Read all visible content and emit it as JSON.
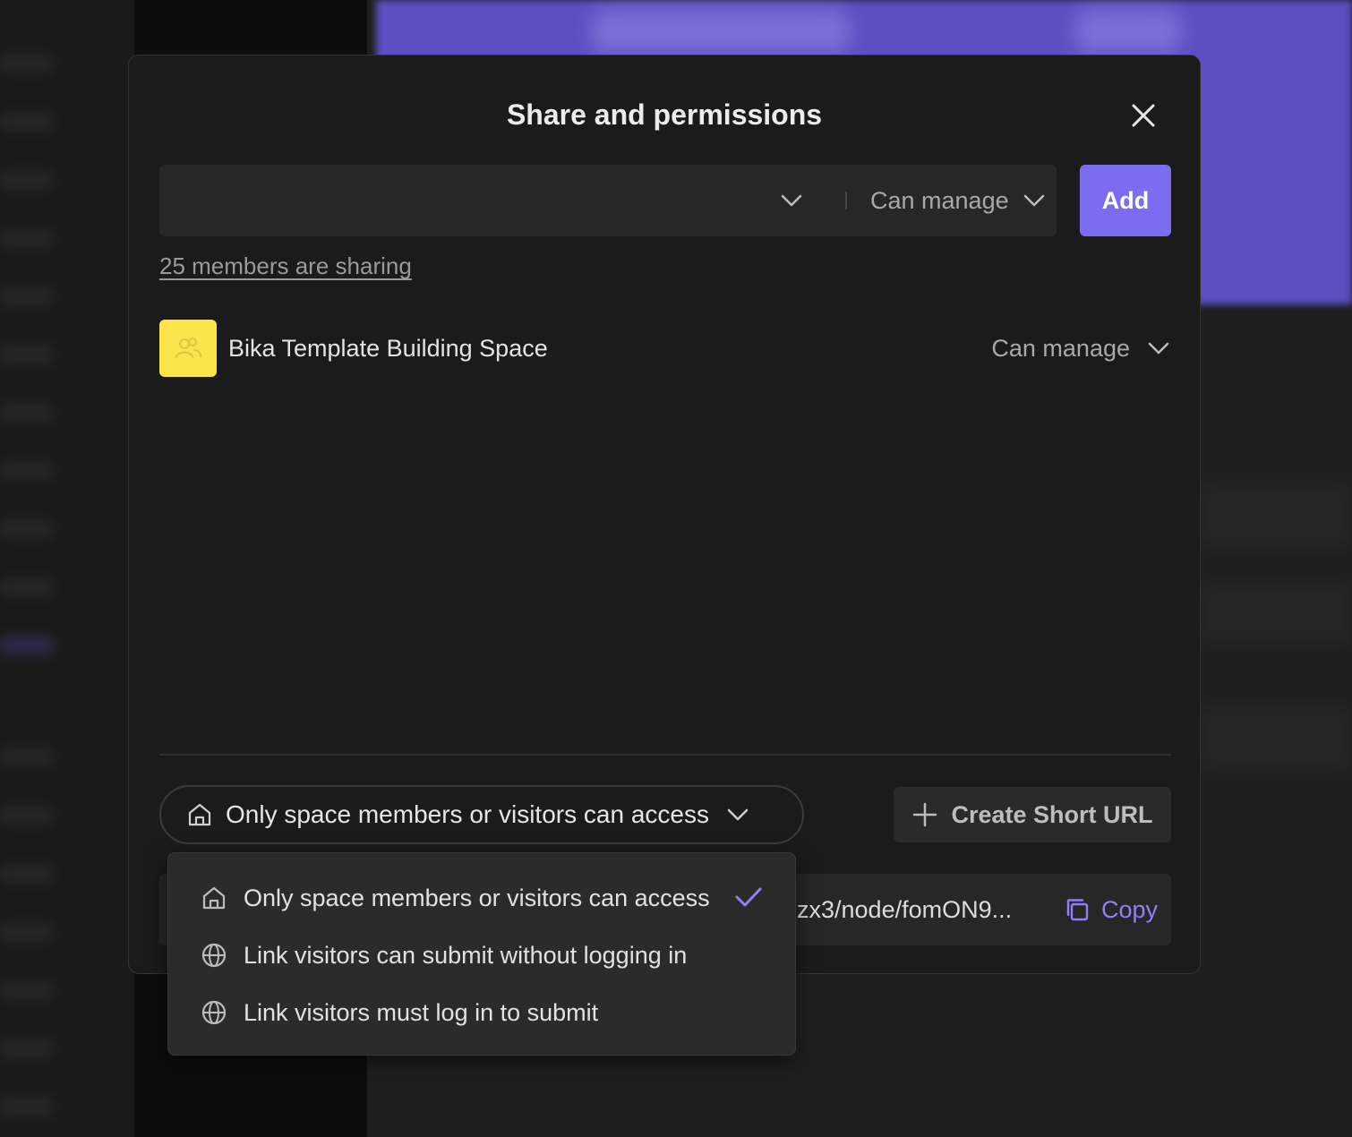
{
  "modal": {
    "title": "Share and permissions"
  },
  "invite": {
    "member_placeholder": "",
    "role_label": "Can manage",
    "add_label": "Add"
  },
  "sharing_summary": "25 members are sharing",
  "members": [
    {
      "name": "Bika Template Building Space",
      "role": "Can manage",
      "avatar_icon": "group-icon",
      "avatar_color": "#fbe44c"
    }
  ],
  "access": {
    "selected": "Only space members or visitors can access",
    "options": [
      {
        "label": "Only space members or visitors can access",
        "icon": "home-icon",
        "selected": true
      },
      {
        "label": "Link visitors can submit without logging in",
        "icon": "globe-icon",
        "selected": false
      },
      {
        "label": "Link visitors must log in to submit",
        "icon": "globe-icon",
        "selected": false
      }
    ]
  },
  "short_url": {
    "label": "Create Short URL"
  },
  "share_link": {
    "url_visible": "zx3/node/fomON9...",
    "copy_label": "Copy"
  },
  "colors": {
    "accent": "#7b6cf0",
    "accent_text": "#8f80f5",
    "modal_bg": "#1b1b1b",
    "avatar": "#fbe44c"
  }
}
